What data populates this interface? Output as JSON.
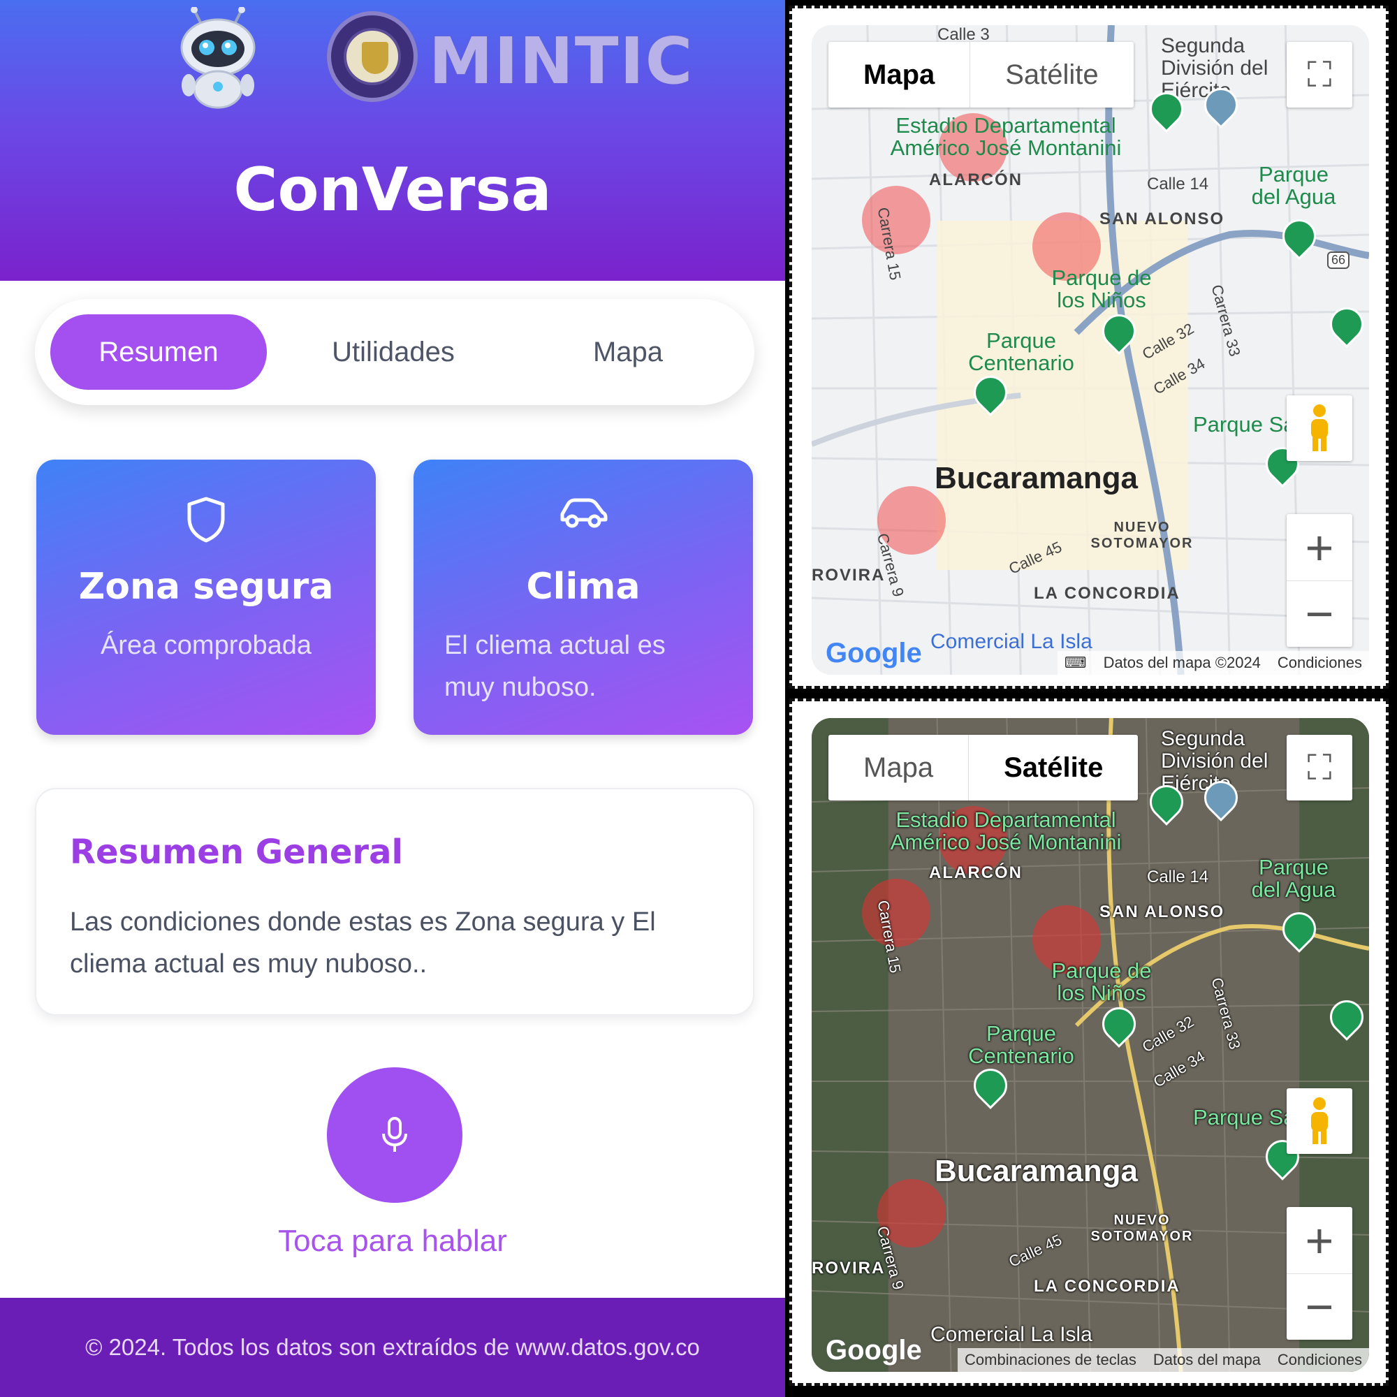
{
  "phone": {
    "brand": "MINTIC",
    "app_title": "ConVersa",
    "tabs": [
      "Resumen",
      "Utilidades",
      "Mapa"
    ],
    "active_tab": "Resumen",
    "cards": [
      {
        "icon": "shield-icon",
        "title": "Zona segura",
        "subtitle": "Área comprobada"
      },
      {
        "icon": "car-icon",
        "title": "Clima",
        "subtitle": "El cliema actual es muy nuboso."
      }
    ],
    "summary": {
      "title": "Resumen General",
      "text": "Las condiciones donde estas es Zona segura y El cliema actual es muy nuboso.."
    },
    "mic_label": "Toca para hablar",
    "footer": "© 2024. Todos los datos son extraídos de www.datos.gov.co",
    "colors": {
      "accent": "#a44ff0",
      "header_top": "#4a6ef0",
      "header_bottom": "#7a22cc",
      "footer": "#6b1eb5"
    }
  },
  "map_top": {
    "map_types": [
      "Mapa",
      "Satélite"
    ],
    "selected": "Mapa",
    "labels": {
      "estadio": "Estadio Departamental Américo José Montanini",
      "segunda": "Segunda División del Ejército",
      "alarcon": "ALARCÓN",
      "calle14": "Calle 14",
      "parque_agua": "Parque del Agua",
      "san_alonso": "SAN ALONSO",
      "carrera15": "Carrera 15",
      "parque_ninos": "Parque de los Niños",
      "parque_centenario": "Parque Centenario",
      "calle32": "Calle 32",
      "carrera33": "Carrera 33",
      "calle34": "Calle 34",
      "parque_sa": "Parque Sa",
      "city": "Bucaramanga",
      "carrera9": "Carrera 9",
      "calle45": "Calle 45",
      "nuevo_sotomayor": "NUEVO SOTOMAYOR",
      "rovira": "ROVIRA",
      "concordia": "LA CONCORDIA",
      "comercial": "Comercial La Isla",
      "calle3": "Calle 3",
      "route": "66"
    },
    "attribution": [
      "Datos del mapa ©2024",
      "Condiciones"
    ],
    "logo": "Google"
  },
  "map_bottom": {
    "map_types": [
      "Mapa",
      "Satélite"
    ],
    "selected": "Satélite",
    "attribution": [
      "Combinaciones de teclas",
      "Datos del mapa",
      "Condiciones"
    ],
    "logo": "Google"
  }
}
